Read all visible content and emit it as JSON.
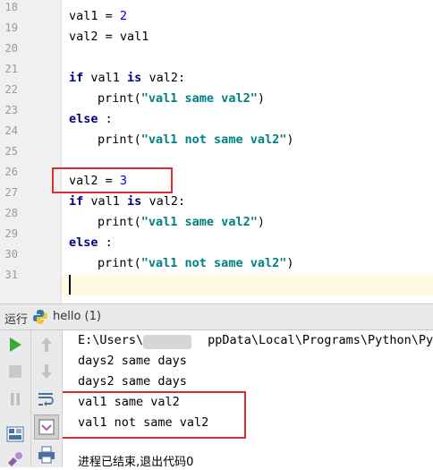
{
  "editor": {
    "line_numbers": [
      "18",
      "19",
      "20",
      "21",
      "22",
      "23",
      "24",
      "25",
      "26",
      "27",
      "28",
      "29",
      "30",
      "31"
    ],
    "lines": {
      "l18_a": "val1 = ",
      "l18_num": "2",
      "l19": "val2 = val1",
      "l21_kw": "if",
      "l21_mid": " val1 ",
      "l21_is": "is",
      "l21_end": " val2:",
      "l22_fn": "print(",
      "l22_str": "\"val1 same val2\"",
      "l22_end": ")",
      "l23_kw": "else",
      "l23_end": " :",
      "l24_fn": "print(",
      "l24_str": "\"val1 not same val2\"",
      "l24_end": ")",
      "l26_a": "val2 = ",
      "l26_num": "3",
      "l27_kw": "if",
      "l27_mid": " val1 ",
      "l27_is": "is",
      "l27_end": " val2:",
      "l28_fn": "print(",
      "l28_str": "\"val1 same val2\"",
      "l28_end": ")",
      "l29_kw": "else",
      "l29_end": " :",
      "l30_fn": "print(",
      "l30_str": "\"val1 not same val2\"",
      "l30_end": ")"
    }
  },
  "run_panel": {
    "tab_label": "运行",
    "config_name": "hello (1)"
  },
  "console": {
    "path_start": "E:\\Users\\",
    "path_rest": "ppData\\Local\\Programs\\Python\\Pyth",
    "lines": [
      "days2 same days",
      "days2 same days",
      "val1 same val2",
      "val1 not same val2"
    ],
    "exit_message": "进程已结束,退出代码0"
  },
  "icons": {
    "run": "play-icon",
    "stop": "stop-icon",
    "pause": "pause-icon",
    "up": "arrow-up-icon",
    "down": "arrow-down-icon",
    "wrap": "soft-wrap-icon",
    "scroll": "scroll-to-end-icon",
    "layout": "layout-icon",
    "print": "print-icon",
    "python": "python-icon"
  },
  "colors": {
    "keyword": "#000080",
    "number": "#0000ff",
    "string": "#008080",
    "annotation": "#d9302e",
    "run_green": "#3aa83a"
  }
}
